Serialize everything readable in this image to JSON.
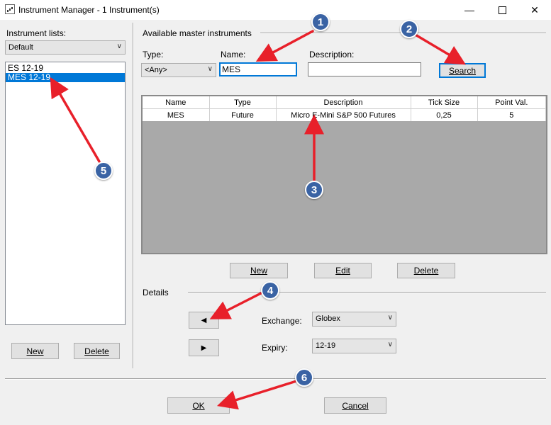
{
  "window": {
    "title": "Instrument Manager - 1 Instrument(s)",
    "controls": [
      "minimize-icon",
      "maximize-icon",
      "close-icon"
    ]
  },
  "left": {
    "lists_label": "Instrument lists:",
    "list_combo_value": "Default",
    "items": [
      {
        "label": "ES 12-19",
        "selected": false
      },
      {
        "label": "MES 12-19",
        "selected": true
      }
    ],
    "new_label": "New",
    "delete_label": "Delete"
  },
  "master": {
    "group_label": "Available master instruments",
    "type_label": "Type:",
    "type_value": "<Any>",
    "name_label": "Name:",
    "name_value": "MES",
    "desc_label": "Description:",
    "desc_value": "",
    "search_label": "Search"
  },
  "grid": {
    "columns": [
      "Name",
      "Type",
      "Description",
      "Tick Size",
      "Point Val."
    ],
    "rows": [
      [
        "MES",
        "Future",
        "Micro E-Mini S&P 500 Futures",
        "0,25",
        "5"
      ]
    ],
    "new_label": "New",
    "edit_label": "Edit",
    "delete_label": "Delete"
  },
  "details": {
    "group_label": "Details",
    "exchange_label": "Exchange:",
    "exchange_value": "Globex",
    "expiry_label": "Expiry:",
    "expiry_value": "12-19"
  },
  "footer": {
    "ok_label": "OK",
    "cancel_label": "Cancel"
  },
  "annotations": {
    "color": "#e8202a",
    "marker_color": "#3a63a4",
    "markers": [
      "1",
      "2",
      "3",
      "4",
      "5",
      "6"
    ]
  }
}
